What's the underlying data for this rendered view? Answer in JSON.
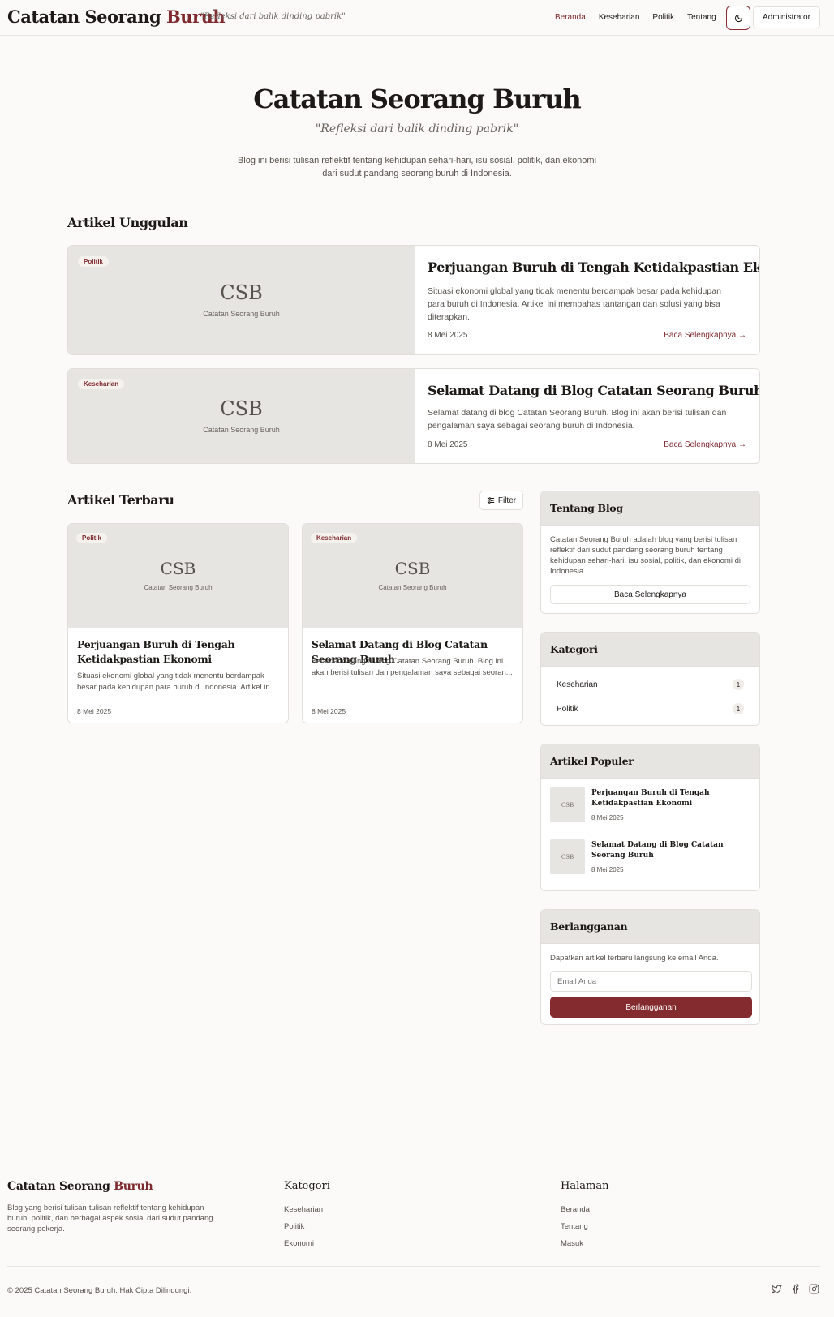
{
  "header": {
    "brand_main": "Catatan Seorang ",
    "brand_accent": "Buruh",
    "tagline": "\"Refleksi dari balik dinding pabrik\"",
    "nav": [
      "Beranda",
      "Keseharian",
      "Politik",
      "Tentang"
    ],
    "theme_icon": "moon-icon",
    "admin_label": "Administrator"
  },
  "hero": {
    "title": "Catatan Seorang Buruh",
    "subtitle": "\"Refleksi dari balik dinding pabrik\"",
    "description": "Blog ini berisi tulisan reflektif tentang kehidupan sehari-hari, isu sosial, politik, dan ekonomi dari sudut pandang seorang buruh di Indonesia."
  },
  "featured": {
    "heading": "Artikel Unggulan",
    "placeholder_logo": "CSB",
    "placeholder_caption": "Catatan Seorang Buruh",
    "items": [
      {
        "badge": "Politik",
        "title": "Perjuangan Buruh di Tengah Ketidakpastian Ekonomi",
        "excerpt": "Situasi ekonomi global yang tidak menentu berdampak besar pada kehidupan para buruh di Indonesia. Artikel ini membahas tantangan dan solusi yang bisa diterapkan.",
        "date": "8 Mei 2025",
        "link": "Baca Selengkapnya →"
      },
      {
        "badge": "Keseharian",
        "title": "Selamat Datang di Blog Catatan Seorang Buruh",
        "excerpt": "Selamat datang di blog Catatan Seorang Buruh. Blog ini akan berisi tulisan dan pengalaman saya sebagai seorang buruh di Indonesia.",
        "date": "8 Mei 2025",
        "link": "Baca Selengkapnya →"
      }
    ]
  },
  "latest": {
    "heading": "Artikel Terbaru",
    "filter_label": "Filter",
    "items": [
      {
        "badge": "Politik",
        "title": "Perjuangan Buruh di Tengah Ketidakpastian Ekonomi",
        "excerpt": "Situasi ekonomi global yang tidak menentu berdampak besar pada kehidupan para buruh di Indonesia. Artikel in...",
        "date": "8 Mei 2025"
      },
      {
        "badge": "Keseharian",
        "title": "Selamat Datang di Blog Catatan Seorang Buruh",
        "excerpt": "Selamat datang di blog Catatan Seorang Buruh. Blog ini akan berisi tulisan dan pengalaman saya sebagai seoran...",
        "date": "8 Mei 2025"
      }
    ]
  },
  "sidebar": {
    "about": {
      "title": "Tentang Blog",
      "text": "Catatan Seorang Buruh adalah blog yang berisi tulisan reflektif dari sudut pandang seorang buruh tentang kehidupan sehari-hari, isu sosial, politik, dan ekonomi di Indonesia.",
      "button": "Baca Selengkapnya"
    },
    "categories": {
      "title": "Kategori",
      "items": [
        {
          "name": "Keseharian",
          "count": "1"
        },
        {
          "name": "Politik",
          "count": "1"
        }
      ]
    },
    "popular": {
      "title": "Artikel Populer",
      "thumb_label": "CSB",
      "items": [
        {
          "title": "Perjuangan Buruh di Tengah Ketidakpastian Ekonomi",
          "date": "8 Mei 2025"
        },
        {
          "title": "Selamat Datang di Blog Catatan Seorang Buruh",
          "date": "8 Mei 2025"
        }
      ]
    },
    "subscribe": {
      "title": "Berlangganan",
      "text": "Dapatkan artikel terbaru langsung ke email Anda.",
      "placeholder": "Email Anda",
      "button": "Berlangganan"
    }
  },
  "footer": {
    "brand_main": "Catatan Seorang ",
    "brand_accent": "Buruh",
    "description": "Blog yang berisi tulisan-tulisan reflektif tentang kehidupan buruh, politik, dan berbagai aspek sosial dari sudut pandang seorang pekerja.",
    "categories_title": "Kategori",
    "categories": [
      "Keseharian",
      "Politik",
      "Ekonomi"
    ],
    "pages_title": "Halaman",
    "pages": [
      "Beranda",
      "Tentang",
      "Masuk"
    ],
    "copyright": "© 2025 Catatan Seorang Buruh. Hak Cipta Dilindungi.",
    "social_icons": [
      "twitter-icon",
      "facebook-icon",
      "instagram-icon"
    ]
  },
  "colors": {
    "accent": "#7f2a2f",
    "button": "#832b2e",
    "background": "#fbfaf8",
    "placeholder_bg": "#e7e5e1"
  }
}
